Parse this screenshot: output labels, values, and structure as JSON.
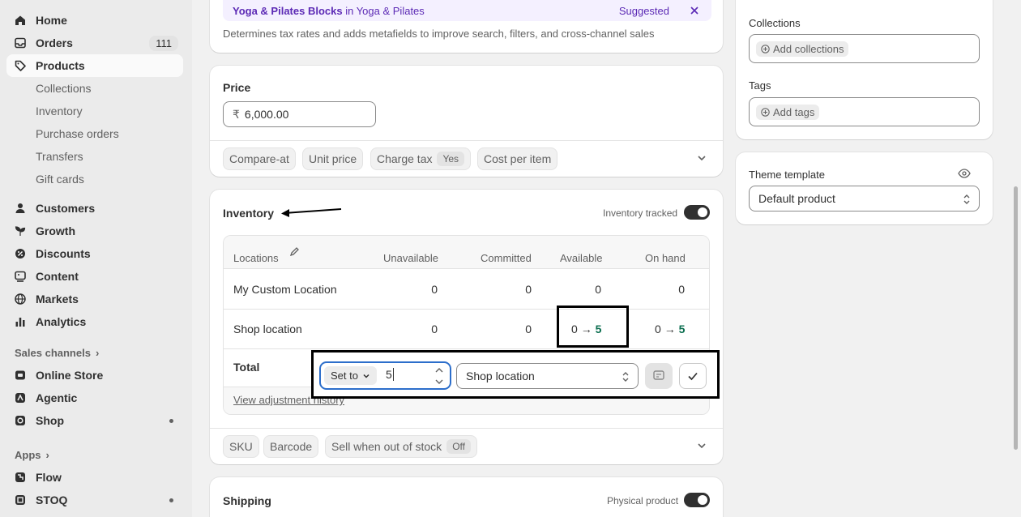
{
  "sidebar": {
    "home": "Home",
    "orders": "Orders",
    "orders_count": "111",
    "products": "Products",
    "collections": "Collections",
    "inventory": "Inventory",
    "purchase_orders": "Purchase orders",
    "transfers": "Transfers",
    "gift_cards": "Gift cards",
    "customers": "Customers",
    "growth": "Growth",
    "discounts": "Discounts",
    "content": "Content",
    "markets": "Markets",
    "analytics": "Analytics",
    "sales_channels": "Sales channels",
    "online_store": "Online Store",
    "agentic": "Agentic",
    "shop": "Shop",
    "apps": "Apps",
    "flow": "Flow",
    "stoq": "STOQ"
  },
  "category": {
    "suggestion_bold": "Yoga & Pilates Blocks",
    "suggestion_rest": " in Yoga & Pilates",
    "suggested": "Suggested",
    "help": "Determines tax rates and adds metafields to improve search, filters, and cross-channel sales"
  },
  "price": {
    "title": "Price",
    "currency": "₹",
    "value": "6,000.00",
    "compare_at": "Compare-at",
    "unit_price": "Unit price",
    "charge_tax": "Charge tax",
    "charge_tax_value": "Yes",
    "cost_per_item": "Cost per item"
  },
  "inventory": {
    "title": "Inventory",
    "tracked_label": "Inventory tracked",
    "headers": {
      "locations": "Locations",
      "unavailable": "Unavailable",
      "committed": "Committed",
      "available": "Available",
      "on_hand": "On hand"
    },
    "rows": [
      {
        "location": "My Custom Location",
        "unavailable": "0",
        "committed": "0",
        "available": "0",
        "on_hand": "0"
      },
      {
        "location": "Shop location",
        "unavailable": "0",
        "committed": "0",
        "available_from": "0",
        "available_to": "5",
        "on_hand_from": "0",
        "on_hand_to": "5"
      }
    ],
    "total": "Total",
    "history": "View adjustment history",
    "arrow": "→",
    "sku": "SKU",
    "barcode": "Barcode",
    "sell_oos": "Sell when out of stock",
    "sell_oos_value": "Off"
  },
  "popover": {
    "mode": "Set to",
    "quantity": "5",
    "location": "Shop location"
  },
  "shipping": {
    "title": "Shipping",
    "physical": "Physical product"
  },
  "organization": {
    "collections_label": "Collections",
    "add_collections": "Add collections",
    "tags_label": "Tags",
    "add_tags": "Add tags"
  },
  "theme": {
    "label": "Theme template",
    "value": "Default product"
  }
}
